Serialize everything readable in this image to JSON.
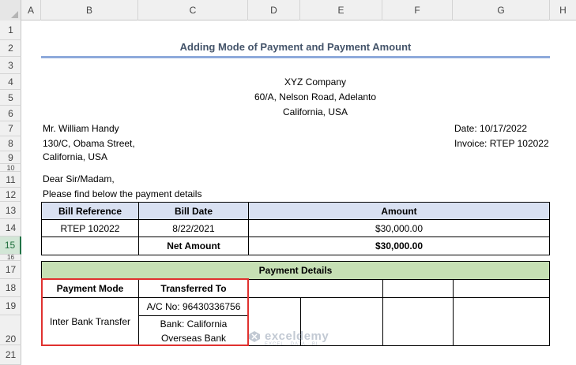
{
  "columns": [
    "A",
    "B",
    "C",
    "D",
    "E",
    "F",
    "G",
    "H"
  ],
  "rows": [
    "1",
    "2",
    "3",
    "4",
    "5",
    "6",
    "7",
    "8",
    "9",
    "10",
    "11",
    "12",
    "13",
    "14",
    "15",
    "16",
    "17",
    "18",
    "19",
    "20",
    "21"
  ],
  "selected_row": "15",
  "title": "Adding Mode of Payment and Payment Amount",
  "company": {
    "name": "XYZ Company",
    "address1": "60/A, Nelson Road, Adelanto",
    "address2": "California, USA"
  },
  "recipient": {
    "name": "Mr. William Handy",
    "street": "130/C, Obama Street,",
    "city": "California, USA"
  },
  "meta": {
    "date": "Date: 10/17/2022",
    "invoice": "Invoice: RTEP 102022"
  },
  "greeting": "Dear Sir/Madam,",
  "intro": "Please find below the payment details",
  "bill_table": {
    "headers": [
      "Bill Reference",
      "Bill Date",
      "Amount"
    ],
    "row": [
      "RTEP 102022",
      "8/22/2021",
      "$30,000.00"
    ],
    "net_label": "Net Amount",
    "net_value": "$30,000.00"
  },
  "payment_table": {
    "title": "Payment Details",
    "headers": [
      "Payment Mode",
      "Transferred To"
    ],
    "mode": "Inter Bank Transfer",
    "account": "A/C No: 96430336756",
    "bank_line1": "Bank: California",
    "bank_line2": "Overseas Bank"
  },
  "watermark": {
    "name": "exceldemy",
    "tagline": "EXCEL · DATA · BI"
  },
  "colors": {
    "title": "#44546a",
    "header_fill": "#d9e1f2",
    "payment_title_fill": "#c6e0b4",
    "highlight_border": "#e0312f"
  }
}
